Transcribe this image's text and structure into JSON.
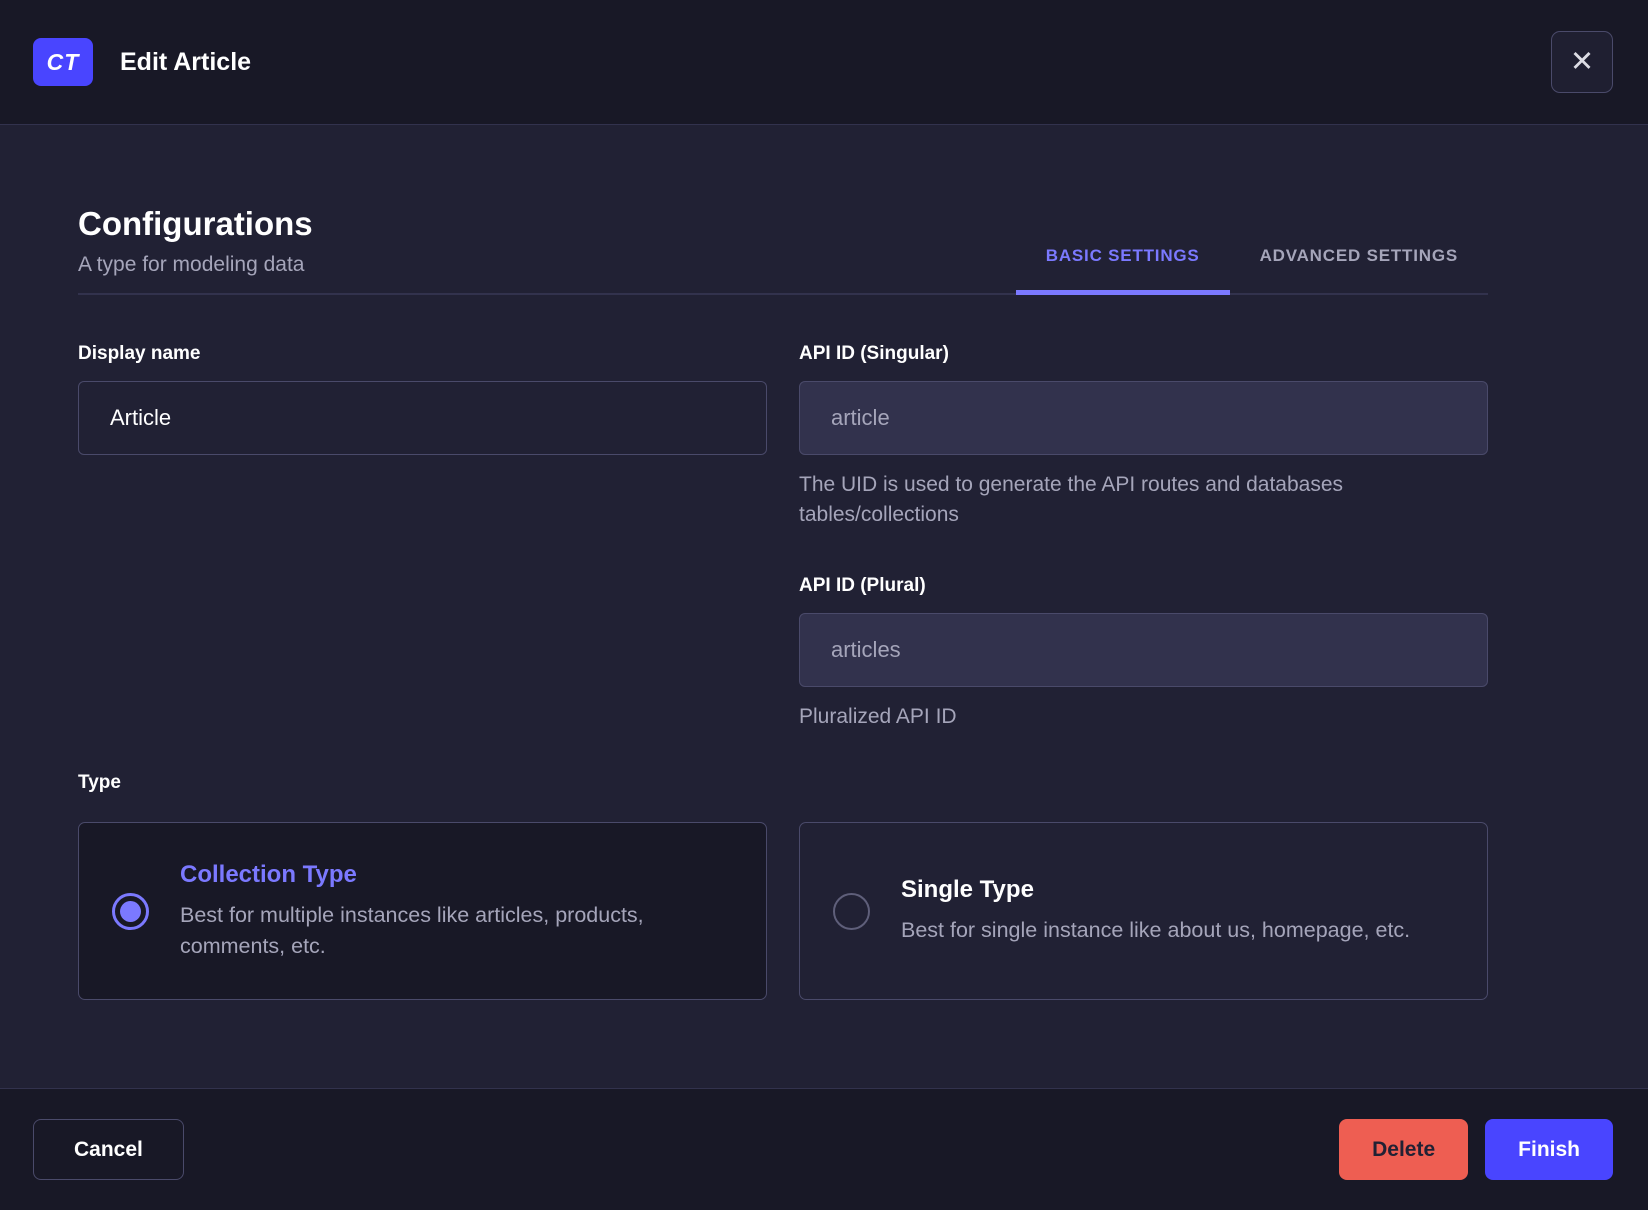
{
  "colors": {
    "primary": "#4945ff",
    "primary_light": "#7b79ff",
    "danger": "#ee5e52",
    "body_background": "#212134",
    "surface_dark": "#181826",
    "border": "#4a4a6a",
    "text_muted": "#a5a5ba"
  },
  "header": {
    "badge": "CT",
    "title": "Edit Article"
  },
  "icons": {
    "close": "✕"
  },
  "intro": {
    "title": "Configurations",
    "subtitle": "A type for modeling data"
  },
  "tabs": {
    "items": [
      {
        "label": "BASIC SETTINGS",
        "active": true
      },
      {
        "label": "ADVANCED SETTINGS",
        "active": false
      }
    ]
  },
  "form": {
    "display_name": {
      "label": "Display name",
      "value": "Article"
    },
    "api_id_singular": {
      "label": "API ID (Singular)",
      "value": "article",
      "hint": "The UID is used to generate the API routes and databases tables/collections"
    },
    "api_id_plural": {
      "label": "API ID (Plural)",
      "value": "articles",
      "hint": "Pluralized API ID"
    },
    "type": {
      "label": "Type",
      "options": [
        {
          "title": "Collection Type",
          "description": "Best for multiple instances like articles, products, comments, etc.",
          "selected": true
        },
        {
          "title": "Single Type",
          "description": "Best for single instance like about us, homepage, etc.",
          "selected": false
        }
      ]
    }
  },
  "footer": {
    "cancel": "Cancel",
    "delete": "Delete",
    "finish": "Finish"
  }
}
